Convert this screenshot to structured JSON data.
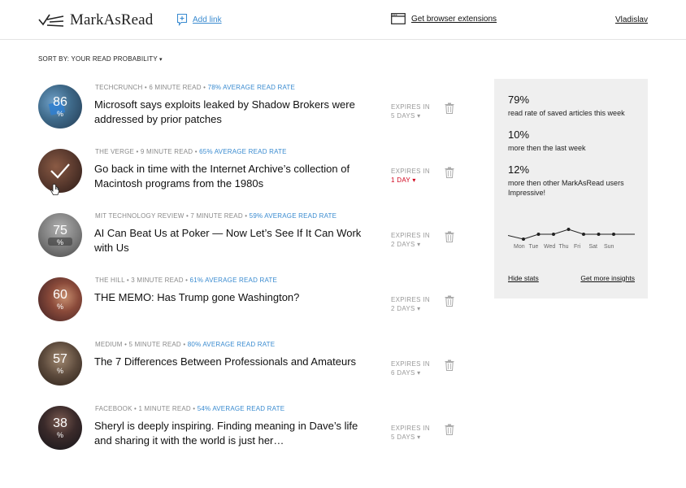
{
  "header": {
    "logo_text": "MarkAsRead",
    "add_link_label": "Add link",
    "extensions_label": "Get browser extensions",
    "user_name": "Vladislav"
  },
  "sort": {
    "label": "SORT BY: YOUR READ PROBABILITY",
    "caret": "▾"
  },
  "articles": [
    {
      "percent": "86",
      "source": "TECHCRUNCH",
      "read_time": "6 MINUTE READ",
      "read_rate": "78% AVERAGE READ RATE",
      "title": "Microsoft says exploits leaked by Shadow Brokers were addressed by prior patches",
      "expires_label": "EXPIRES IN",
      "expires_value": "5 DAYS ▾",
      "urgent": false,
      "avatar_color": "#3f6a8a"
    },
    {
      "percent": "",
      "source": "THE VERGE",
      "read_time": "9 MINUTE READ",
      "read_rate": "65% AVERAGE READ RATE",
      "title": "Go back in time with the Internet Archive’s collection of Macintosh programs from the 1980s",
      "expires_label": "EXPIRES IN",
      "expires_value": "1 DAY ▾",
      "urgent": true,
      "avatar_color": "#5a3a2e"
    },
    {
      "percent": "75",
      "source": "MIT TECHNOLOGY REVIEW",
      "read_time": "7 MINUTE READ",
      "read_rate": "59% AVERAGE READ RATE",
      "title": "AI Can Beat Us at Poker — Now Let’s See If It Can Work with Us",
      "expires_label": "EXPIRES IN",
      "expires_value": "2 DAYS ▾",
      "urgent": false,
      "avatar_color": "#7a7a7a"
    },
    {
      "percent": "60",
      "source": "THE HILL",
      "read_time": "3 MINUTE READ",
      "read_rate": "61% AVERAGE READ RATE",
      "title": "THE MEMO: Has Trump gone Washington?",
      "expires_label": "EXPIRES IN",
      "expires_value": "2 DAYS ▾",
      "urgent": false,
      "avatar_color": "#6b3a3a"
    },
    {
      "percent": "57",
      "source": "MEDIUM",
      "read_time": "5 MINUTE READ",
      "read_rate": "80% AVERAGE READ RATE",
      "title": "The 7 Differences Between Professionals and Amateurs",
      "expires_label": "EXPIRES IN",
      "expires_value": "6 DAYS ▾",
      "urgent": false,
      "avatar_color": "#5c4a3c"
    },
    {
      "percent": "38",
      "source": "FACEBOOK",
      "read_time": "1 MINUTE READ",
      "read_rate": "54% AVERAGE READ RATE",
      "title": "Sheryl is deeply inspiring. Finding meaning in Dave’s life and sharing it with the world is just her…",
      "expires_label": "EXPIRES IN",
      "expires_value": "5 DAYS ▾",
      "urgent": false,
      "avatar_color": "#2a2a30"
    }
  ],
  "stats": {
    "items": [
      {
        "num": "79%",
        "desc": "read rate of saved articles this week"
      },
      {
        "num": "10%",
        "desc": "more then the last week"
      },
      {
        "num": "12%",
        "desc": "more then other MarkAsRead users Impressive!"
      }
    ],
    "days": [
      "Mon",
      "Tue",
      "Wed",
      "Thu",
      "Fri",
      "Sat",
      "Sun"
    ],
    "week_values": [
      2,
      5,
      5,
      8,
      5,
      5,
      5
    ],
    "hide_label": "Hide stats",
    "insights_label": "Get more insights"
  },
  "colors": {
    "accent": "#3a8bd0",
    "urgent": "#d0021b",
    "panel_bg": "#efefef"
  }
}
